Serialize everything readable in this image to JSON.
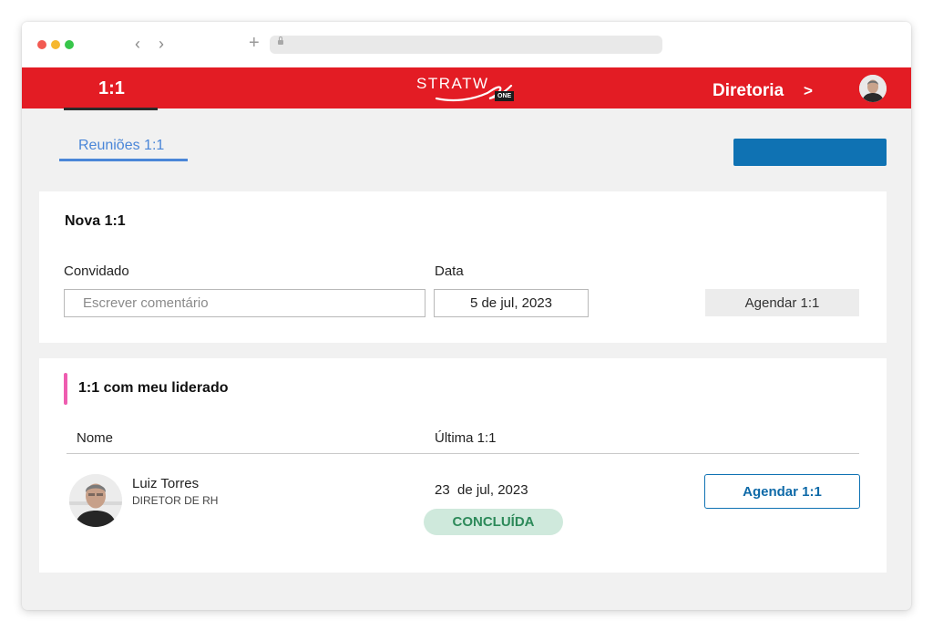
{
  "browser": {
    "traffic_lights": {
      "close": "#f25a52",
      "minimize": "#f6b830",
      "maximize": "#37c64a"
    },
    "back_glyph": "‹",
    "forward_glyph": "›",
    "new_tab_glyph": "+"
  },
  "header": {
    "page_title": "1:1",
    "logo_text": "STRATW",
    "logo_badge": "ONE",
    "org_label": "Diretoria",
    "org_chevron": ">",
    "brand_color": "#e31c24"
  },
  "tabs": [
    {
      "label": "Reuniões 1:1",
      "active": true
    }
  ],
  "new_meeting": {
    "title": "Nova 1:1",
    "guest_label": "Convidado",
    "guest_placeholder": "Escrever comentário",
    "guest_value": "",
    "date_label": "Data",
    "date_value": "5 de jul, 2023",
    "submit_label": "Agendar 1:1"
  },
  "team": {
    "title": "1:1 com meu liderado",
    "col_name": "Nome",
    "col_last": "Última 1:1",
    "rows": [
      {
        "name": "Luiz Torres",
        "role": "DIRETOR DE RH",
        "last_date": "23  de jul, 2023",
        "status": "CONCLUÍDA",
        "action_label": "Agendar 1:1"
      }
    ]
  },
  "colors": {
    "primary_button": "#0f72b3",
    "tab_accent": "#4a86d8",
    "section_accent": "#ee5db0",
    "status_bg": "#cfe9dc",
    "status_text": "#2d8a5a"
  }
}
